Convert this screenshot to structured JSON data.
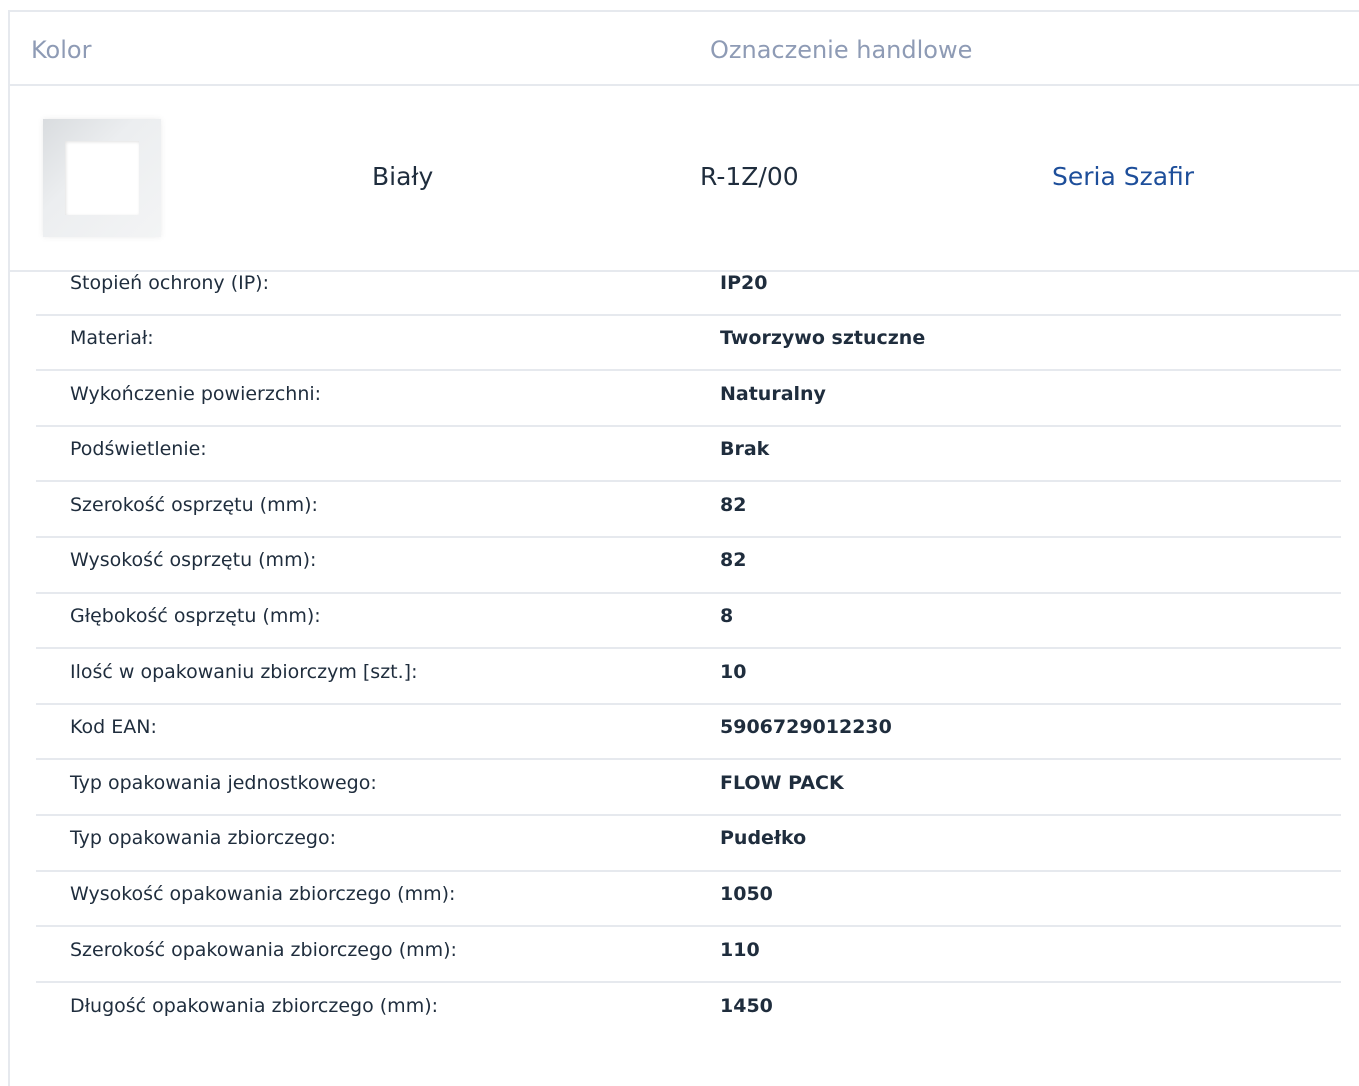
{
  "header": {
    "kolor": "Kolor",
    "oznaczenie": "Oznaczenie handlowe"
  },
  "variant": {
    "color_name": "Biały",
    "code": "R-1Z/00",
    "series_link": "Seria Szafir"
  },
  "specs": [
    {
      "label": "Stopień ochrony (IP):",
      "value": "IP20"
    },
    {
      "label": "Materiał:",
      "value": "Tworzywo sztuczne"
    },
    {
      "label": "Wykończenie powierzchni:",
      "value": "Naturalny"
    },
    {
      "label": "Podświetlenie:",
      "value": "Brak"
    },
    {
      "label": "Szerokość osprzętu (mm):",
      "value": "82"
    },
    {
      "label": "Wysokość osprzętu (mm):",
      "value": "82"
    },
    {
      "label": "Głębokość osprzętu (mm):",
      "value": "8"
    },
    {
      "label": "Ilość w opakowaniu zbiorczym [szt.]:",
      "value": "10"
    },
    {
      "label": "Kod EAN:",
      "value": "5906729012230"
    },
    {
      "label": "Typ opakowania jednostkowego:",
      "value": "FLOW PACK"
    },
    {
      "label": "Typ opakowania zbiorczego:",
      "value": "Pudełko"
    },
    {
      "label": "Wysokość opakowania zbiorczego (mm):",
      "value": "1050"
    },
    {
      "label": "Szerokość opakowania zbiorczego (mm):",
      "value": "110"
    },
    {
      "label": "Długość opakowania zbiorczego (mm):",
      "value": "1450"
    }
  ]
}
